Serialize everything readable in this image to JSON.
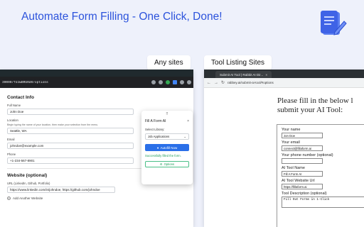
{
  "headline": "Automate Form Filling - One Click, Done!",
  "labels": {
    "any_sites": "Any sites",
    "tool_listing": "Tool Listing Sites"
  },
  "left": {
    "url": "30000/fdJwBRU0d0/options",
    "section_contact": "Contact Info",
    "full_name_label": "Full Name",
    "full_name_value": "John Doe",
    "location_label": "Location",
    "location_hint": "Begin typing the name of your location, then make your selection from the menu.",
    "location_value": "Seattle, WA",
    "email_label": "Email",
    "email_value": "johndoe@example.com",
    "phone_label": "Phone",
    "phone_value": "+1-234-567-8901",
    "section_website": "Website (optional)",
    "website_label": "URL (LinkedIn, Github, Portfolio)",
    "website_value": "https://www.linkedin.com/in/johndoe, https://github.com/johndoe",
    "add_another": "Add Another Website"
  },
  "popup": {
    "title": "Fill A Form AI",
    "close": "×",
    "select_label": "Select Library:",
    "select_value": "Job Applications",
    "autofill_label": "Autofill Now",
    "success": "Successfully filled the form.",
    "options_label": "Options"
  },
  "right": {
    "tab_title": "Submit AI Tool | Rabbit AI Dir...",
    "url": "rabbey.ai/submit-ai-tool/#options",
    "heading_line1": "Please fill in the below l",
    "heading_line2": "submit your AI Tool:",
    "name_label": "Your name",
    "name_value": "Jon Doe",
    "email_label": "Your email",
    "email_value": "connect@fillaform.ai",
    "phone_label": "Your phone number (optional)",
    "phone_value": "",
    "tool_name_label": "AI Tool Name",
    "tool_name_value": "Fill A Form AI",
    "tool_url_label": "AI Tool Website Url",
    "tool_url_value": "https://fillaform.ai",
    "desc_label": "Tool Description (optional)",
    "desc_value": "Fill Out Forms in 1-Click"
  }
}
